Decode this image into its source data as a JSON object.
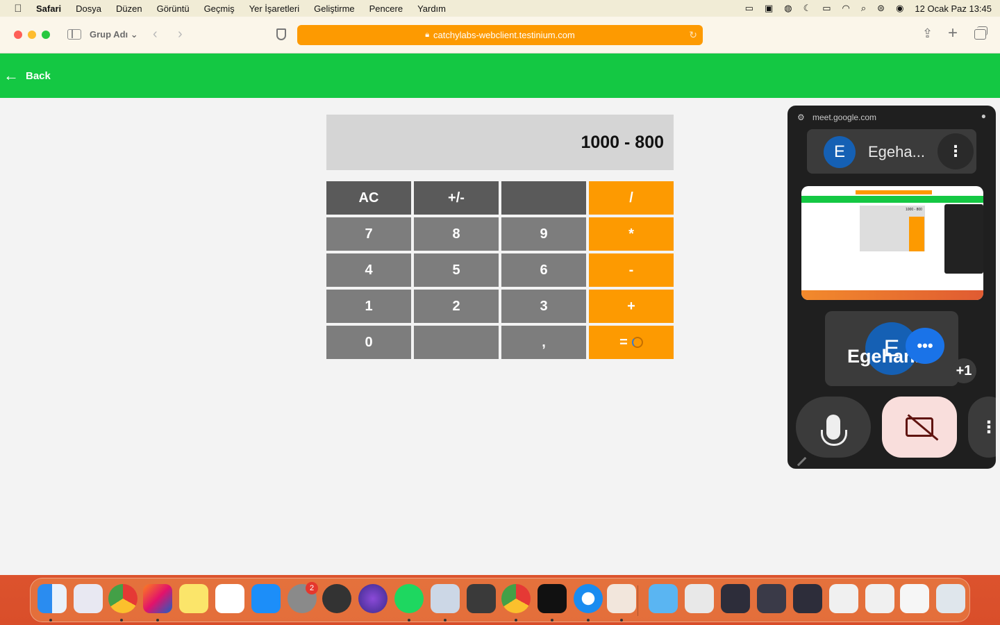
{
  "menubar": {
    "app_name": "Safari",
    "menus": [
      "Dosya",
      "Düzen",
      "Görüntü",
      "Geçmiş",
      "Yer İşaretleri",
      "Geliştirme",
      "Pencere",
      "Yardım"
    ],
    "clock": "12 Ocak Paz  13:45"
  },
  "browser": {
    "tab_group": "Grup Adı ⌄",
    "url": "catchylabs-webclient.testinium.com",
    "address_bar_color": "#fd9a01"
  },
  "page": {
    "header_color": "#14c843",
    "back_label": "Back"
  },
  "calculator": {
    "display": "1000 - 800",
    "keys": [
      "AC",
      "+/-",
      "",
      "/",
      "7",
      "8",
      "9",
      "*",
      "4",
      "5",
      "6",
      "-",
      "1",
      "2",
      "3",
      "+",
      "0",
      "",
      ",",
      "="
    ]
  },
  "meet": {
    "url": "meet.google.com",
    "participant_initial": "E",
    "participant_name": "Egeha...",
    "thumbnail_display": "1000 - 800",
    "tile_initial": "E",
    "tile_name": "Egehan...",
    "extra_participants": "+1"
  },
  "dock": {
    "settings_badge": "2"
  }
}
